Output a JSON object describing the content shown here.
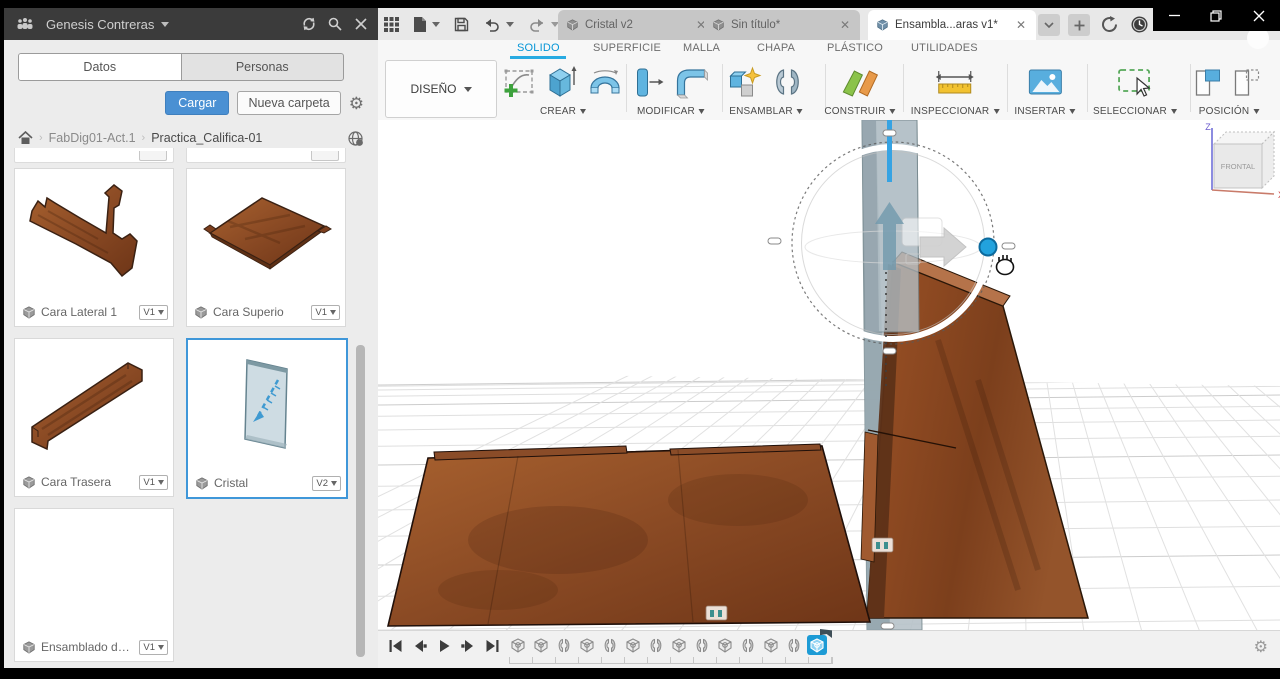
{
  "left_panel": {
    "user": "Genesis Contreras",
    "tabs": [
      {
        "label": "Datos",
        "active": true
      },
      {
        "label": "Personas",
        "active": false
      }
    ],
    "upload_button": "Cargar",
    "new_folder_button": "Nueva carpeta",
    "breadcrumb": [
      "FabDig01-Act.1",
      "Practica_Califica-01"
    ],
    "cards": [
      {
        "label": "Cara Lateral 1",
        "version": "V1",
        "selected": false
      },
      {
        "label": "Cara Superio",
        "version": "V1",
        "selected": false
      },
      {
        "label": "Cara Trasera",
        "version": "V1",
        "selected": false
      },
      {
        "label": "Cristal",
        "version": "V2",
        "selected": true
      },
      {
        "label": "Ensamblado de ...",
        "version": "V1",
        "selected": false
      }
    ]
  },
  "document_tabs": [
    {
      "label": "Cristal v2",
      "active": false
    },
    {
      "label": "Sin título*",
      "active": false
    },
    {
      "label": "Ensambla...aras v1*",
      "active": true
    }
  ],
  "ribbon": {
    "workspace": "DISEÑO",
    "tabs": [
      {
        "label": "SOLIDO",
        "active": true
      },
      {
        "label": "SUPERFICIE",
        "active": false
      },
      {
        "label": "MALLA",
        "active": false
      },
      {
        "label": "CHAPA",
        "active": false
      },
      {
        "label": "PLÁSTICO",
        "active": false
      },
      {
        "label": "UTILIDADES",
        "active": false
      }
    ],
    "groups": [
      {
        "label": "CREAR"
      },
      {
        "label": "MODIFICAR"
      },
      {
        "label": "ENSAMBLAR"
      },
      {
        "label": "CONSTRUIR"
      },
      {
        "label": "INSPECCIONAR"
      },
      {
        "label": "INSERTAR"
      },
      {
        "label": "SELECCIONAR"
      },
      {
        "label": "POSICIÓN"
      }
    ]
  },
  "viewport": {
    "view_cube": {
      "front": "FRONTAL",
      "z": "Z",
      "x": "X"
    }
  },
  "timeline": {
    "features": [
      {
        "type": "component"
      },
      {
        "type": "component"
      },
      {
        "type": "joint"
      },
      {
        "type": "component"
      },
      {
        "type": "joint"
      },
      {
        "type": "component"
      },
      {
        "type": "joint"
      },
      {
        "type": "component"
      },
      {
        "type": "joint"
      },
      {
        "type": "component"
      },
      {
        "type": "joint"
      },
      {
        "type": "component"
      },
      {
        "type": "joint"
      },
      {
        "type": "component",
        "current": true
      }
    ]
  },
  "colors": {
    "accent_blue": "#0696d7",
    "selection_blue": "#3f97d9",
    "upload_button_blue": "#4a90d3",
    "wood": "#8a4a24",
    "glass": "#b7c3c9",
    "panel_header": "#3b3b3b"
  }
}
